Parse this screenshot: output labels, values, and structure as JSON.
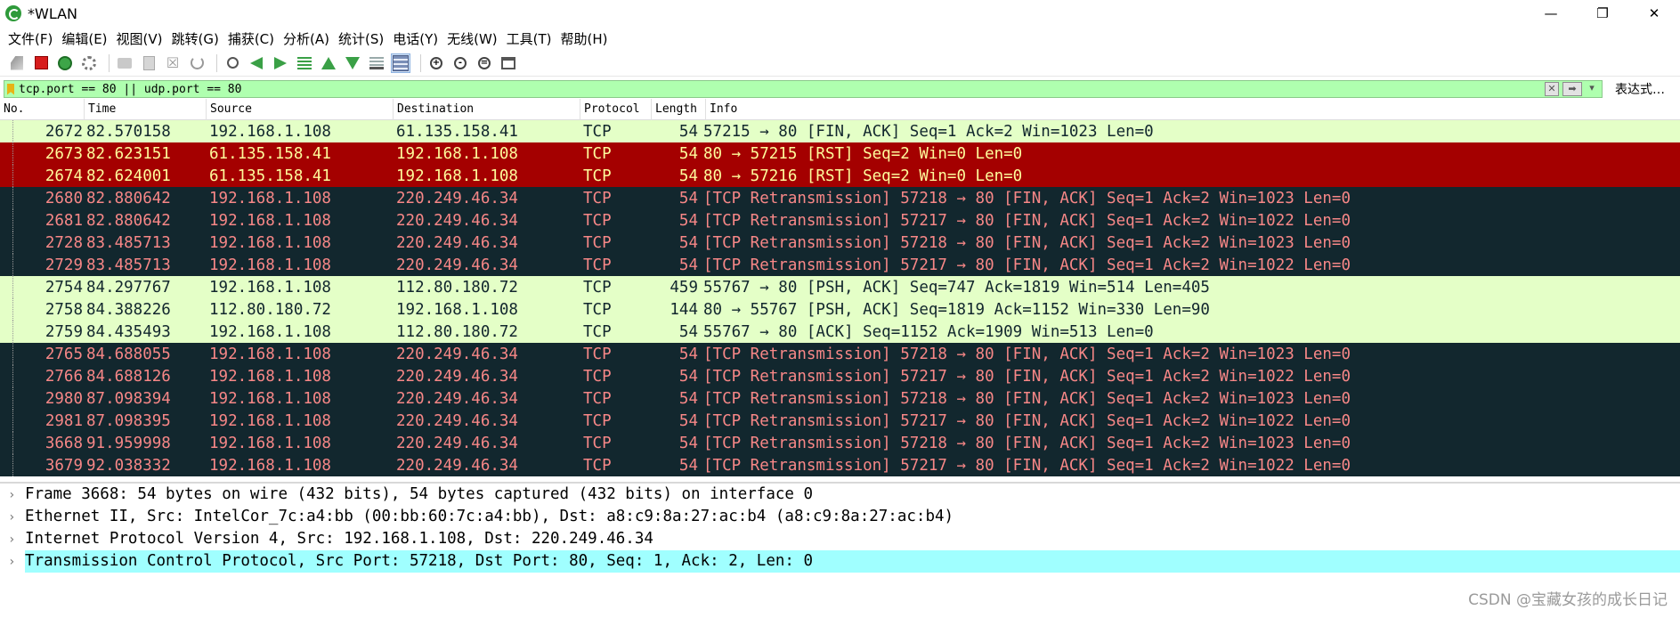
{
  "window": {
    "title": "*WLAN",
    "minimize": "—",
    "restore": "❐",
    "close": "✕"
  },
  "menu": [
    "文件(F)",
    "编辑(E)",
    "视图(V)",
    "跳转(G)",
    "捕获(C)",
    "分析(A)",
    "统计(S)",
    "电话(Y)",
    "无线(W)",
    "工具(T)",
    "帮助(H)"
  ],
  "toolbar": {
    "icons": [
      "shark-fin-start-icon",
      "stop-icon",
      "restart-icon",
      "capture-options-icon",
      "open-icon",
      "save-icon",
      "close-file-icon",
      "reload-icon",
      "find-icon",
      "go-back-icon",
      "go-forward-icon",
      "go-to-packet-icon",
      "go-first-icon",
      "go-last-icon",
      "autoscroll-icon",
      "colorize-icon",
      "zoom-in-icon",
      "zoom-out-icon",
      "zoom-normal-icon",
      "resize-columns-icon"
    ]
  },
  "filter": {
    "value": "tcp.port == 80 || udp.port == 80",
    "clear": "✕",
    "apply": "➡",
    "dropdown": "▾",
    "expression_label": "表达式…"
  },
  "columns": [
    "No.",
    "Time",
    "Source",
    "Destination",
    "Protocol",
    "Length",
    "Info"
  ],
  "packets": [
    {
      "no": "2672",
      "time": "82.570158",
      "src": "192.168.1.108",
      "dst": "61.135.158.41",
      "proto": "TCP",
      "len": "54",
      "info": "57215 → 80 [FIN, ACK] Seq=1 Ack=2 Win=1023 Len=0",
      "style": "tcp"
    },
    {
      "no": "2673",
      "time": "82.623151",
      "src": "61.135.158.41",
      "dst": "192.168.1.108",
      "proto": "TCP",
      "len": "54",
      "info": "80 → 57215 [RST] Seq=2 Win=0 Len=0",
      "style": "rst"
    },
    {
      "no": "2674",
      "time": "82.624001",
      "src": "61.135.158.41",
      "dst": "192.168.1.108",
      "proto": "TCP",
      "len": "54",
      "info": "80 → 57216 [RST] Seq=2 Win=0 Len=0",
      "style": "rst"
    },
    {
      "no": "2680",
      "time": "82.880642",
      "src": "192.168.1.108",
      "dst": "220.249.46.34",
      "proto": "TCP",
      "len": "54",
      "info": "[TCP Retransmission] 57218 → 80 [FIN, ACK] Seq=1 Ack=2 Win=1023 Len=0",
      "style": "bad"
    },
    {
      "no": "2681",
      "time": "82.880642",
      "src": "192.168.1.108",
      "dst": "220.249.46.34",
      "proto": "TCP",
      "len": "54",
      "info": "[TCP Retransmission] 57217 → 80 [FIN, ACK] Seq=1 Ack=2 Win=1022 Len=0",
      "style": "bad"
    },
    {
      "no": "2728",
      "time": "83.485713",
      "src": "192.168.1.108",
      "dst": "220.249.46.34",
      "proto": "TCP",
      "len": "54",
      "info": "[TCP Retransmission] 57218 → 80 [FIN, ACK] Seq=1 Ack=2 Win=1023 Len=0",
      "style": "bad"
    },
    {
      "no": "2729",
      "time": "83.485713",
      "src": "192.168.1.108",
      "dst": "220.249.46.34",
      "proto": "TCP",
      "len": "54",
      "info": "[TCP Retransmission] 57217 → 80 [FIN, ACK] Seq=1 Ack=2 Win=1022 Len=0",
      "style": "bad"
    },
    {
      "no": "2754",
      "time": "84.297767",
      "src": "192.168.1.108",
      "dst": "112.80.180.72",
      "proto": "TCP",
      "len": "459",
      "info": "55767 → 80 [PSH, ACK] Seq=747 Ack=1819 Win=514 Len=405",
      "style": "tcp"
    },
    {
      "no": "2758",
      "time": "84.388226",
      "src": "112.80.180.72",
      "dst": "192.168.1.108",
      "proto": "TCP",
      "len": "144",
      "info": "80 → 55767 [PSH, ACK] Seq=1819 Ack=1152 Win=330 Len=90",
      "style": "tcp"
    },
    {
      "no": "2759",
      "time": "84.435493",
      "src": "192.168.1.108",
      "dst": "112.80.180.72",
      "proto": "TCP",
      "len": "54",
      "info": "55767 → 80 [ACK] Seq=1152 Ack=1909 Win=513 Len=0",
      "style": "tcp"
    },
    {
      "no": "2765",
      "time": "84.688055",
      "src": "192.168.1.108",
      "dst": "220.249.46.34",
      "proto": "TCP",
      "len": "54",
      "info": "[TCP Retransmission] 57218 → 80 [FIN, ACK] Seq=1 Ack=2 Win=1023 Len=0",
      "style": "bad"
    },
    {
      "no": "2766",
      "time": "84.688126",
      "src": "192.168.1.108",
      "dst": "220.249.46.34",
      "proto": "TCP",
      "len": "54",
      "info": "[TCP Retransmission] 57217 → 80 [FIN, ACK] Seq=1 Ack=2 Win=1022 Len=0",
      "style": "bad"
    },
    {
      "no": "2980",
      "time": "87.098394",
      "src": "192.168.1.108",
      "dst": "220.249.46.34",
      "proto": "TCP",
      "len": "54",
      "info": "[TCP Retransmission] 57218 → 80 [FIN, ACK] Seq=1 Ack=2 Win=1023 Len=0",
      "style": "bad"
    },
    {
      "no": "2981",
      "time": "87.098395",
      "src": "192.168.1.108",
      "dst": "220.249.46.34",
      "proto": "TCP",
      "len": "54",
      "info": "[TCP Retransmission] 57217 → 80 [FIN, ACK] Seq=1 Ack=2 Win=1022 Len=0",
      "style": "bad"
    },
    {
      "no": "3668",
      "time": "91.959998",
      "src": "192.168.1.108",
      "dst": "220.249.46.34",
      "proto": "TCP",
      "len": "54",
      "info": "[TCP Retransmission] 57218 → 80 [FIN, ACK] Seq=1 Ack=2 Win=1023 Len=0",
      "style": "bad"
    },
    {
      "no": "3679",
      "time": "92.038332",
      "src": "192.168.1.108",
      "dst": "220.249.46.34",
      "proto": "TCP",
      "len": "54",
      "info": "[TCP Retransmission] 57217 → 80 [FIN, ACK] Seq=1 Ack=2 Win=1022 Len=0",
      "style": "bad"
    }
  ],
  "colors": {
    "tcp_bg": "#e4ffc7",
    "rst_bg": "#a40000",
    "bad_bg": "#12272e",
    "filter_ok_bg": "#afffaf",
    "detail_selected_bg": "#a0ffff"
  },
  "details": [
    {
      "text": "Frame 3668: 54 bytes on wire (432 bits), 54 bytes captured (432 bits) on interface 0",
      "selected": false
    },
    {
      "text": "Ethernet II, Src: IntelCor_7c:a4:bb (00:bb:60:7c:a4:bb), Dst: a8:c9:8a:27:ac:b4 (a8:c9:8a:27:ac:b4)",
      "selected": false
    },
    {
      "text": "Internet Protocol Version 4, Src: 192.168.1.108, Dst: 220.249.46.34",
      "selected": false
    },
    {
      "text": "Transmission Control Protocol, Src Port: 57218, Dst Port: 80, Seq: 1, Ack: 2, Len: 0",
      "selected": true
    }
  ],
  "expander_glyph": "›",
  "watermark": "CSDN @宝藏女孩的成长日记"
}
